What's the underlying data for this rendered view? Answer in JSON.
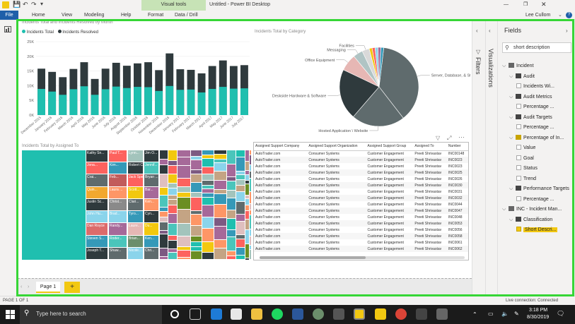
{
  "titlebar": {
    "title": "Untitled - Power BI Desktop",
    "user": "Lee Cullom"
  },
  "ribbon": {
    "tabs": [
      "File",
      "Home",
      "View",
      "Modeling",
      "Help",
      "Format",
      "Data / Drill"
    ],
    "context_group": "Visual tools"
  },
  "chart1": {
    "title": "Incidents Total and Incidents Resolved by Month",
    "legend": [
      "Incidents Total",
      "Incidents Resolved"
    ]
  },
  "chart2": {
    "title": "Incidents Total by Category"
  },
  "chart3": {
    "title": "Incidents Total by Assigned To"
  },
  "chart_data": [
    {
      "type": "bar",
      "title": "Incidents Total and Incidents Resolved by Month",
      "categories": [
        "December 2015",
        "January 2016",
        "February 2016",
        "March 2016",
        "April 2016",
        "May 2016",
        "June 2016",
        "July 2016",
        "August 2016",
        "September 2016",
        "October 2016",
        "November 2016",
        "December 2016",
        "January 2017",
        "February 2017",
        "March 2017",
        "April 2017",
        "May 2017",
        "June 2017",
        "July 2017"
      ],
      "y_ticks": [
        "0K",
        "5K",
        "10K",
        "15K",
        "20K",
        "25K"
      ],
      "ylim": [
        0,
        25000
      ],
      "series": [
        {
          "name": "Incidents Total",
          "color": "#2f3a3d",
          "values": [
            15800,
            14700,
            12900,
            15700,
            18000,
            12300,
            15800,
            17800,
            16800,
            17600,
            18000,
            15300,
            21000,
            15600,
            15400,
            14200,
            16700,
            18600,
            16700,
            17000
          ]
        },
        {
          "name": "Incidents Resolved",
          "color": "#1fbfaf",
          "values": [
            8900,
            8000,
            6900,
            8800,
            9800,
            6900,
            8800,
            9700,
            9200,
            9600,
            9500,
            8200,
            9900,
            8600,
            8700,
            7700,
            8900,
            9600,
            9000,
            9100
          ]
        }
      ]
    },
    {
      "type": "pie",
      "title": "Incidents Total by Category",
      "slices": [
        {
          "label": "Server, Database, & Storage",
          "value": 38,
          "color": "#5f6b6d"
        },
        {
          "label": "Hosted Application \\ Website",
          "value": 22,
          "color": "#5f6b6d"
        },
        {
          "label": "Deskside Hardware & Software",
          "value": 21,
          "color": "#2f3a3d"
        },
        {
          "label": "Office Equipment",
          "value": 7,
          "color": "#e6b7b4"
        },
        {
          "label": "Messaging",
          "value": 4,
          "color": "#b0c4c4"
        },
        {
          "label": "Facilities",
          "value": 3,
          "color": "#d9d9d9"
        },
        {
          "label": "",
          "value": 1.2,
          "color": "#f2c80f"
        },
        {
          "label": "",
          "value": 1.2,
          "color": "#fd625e"
        },
        {
          "label": "",
          "value": 1.2,
          "color": "#8ad4eb"
        },
        {
          "label": "",
          "value": 1.2,
          "color": "#a66999"
        },
        {
          "label": "",
          "value": 1.2,
          "color": "#3599b8"
        }
      ]
    }
  ],
  "treemap": {
    "names": [
      "Kathy Sn...",
      "Paul T...",
      "Lynn...",
      "Jim O...",
      "Jona...",
      "Kim...",
      "Robert C...",
      "Jennif...",
      "Crai...",
      "Feb...",
      "Jack Spe...",
      "Bryan ...",
      "Quin...",
      "Laura ...",
      "Scott...",
      "Bar...",
      "Justin Sc...",
      "Christ...",
      "Clari...",
      "Ken...",
      "John Hu...",
      "Brad...",
      "Tyro...",
      "Cyn...",
      "Dan Royce",
      "Randy...",
      "Laure...",
      "Du...",
      "Steven S...",
      "Roder...",
      "Brian...",
      "Ken...",
      "Joseph T...",
      "Shaw...",
      "Nicole...",
      "Chri..."
    ]
  },
  "table": {
    "columns": [
      "Assigned Support Company",
      "Assigned Support Organization",
      "Assigned Support Group",
      "Assigned To",
      "Number"
    ],
    "company": "AutoTrader.com",
    "org": "Consumer Systems",
    "group": "Customer Engagement",
    "assignee": "Preeti Shrivastav",
    "numbers": [
      "INC00148",
      "INC0023",
      "INC0023",
      "INC0025",
      "INC0026",
      "INC0030",
      "INC0031",
      "INC0032",
      "INC0044",
      "INC0047",
      "INC0048",
      "INC0053",
      "INC0056",
      "INC0058",
      "INC0061",
      "INC0062"
    ]
  },
  "pages": {
    "current": "Page 1",
    "add": "+"
  },
  "filters": {
    "label": "Filters"
  },
  "visualizations": {
    "label": "Visualizations"
  },
  "fields": {
    "title": "Fields",
    "search_value": "short description",
    "tree": [
      {
        "label": "Incident",
        "kind": "group",
        "indent": 0
      },
      {
        "label": "Audit",
        "kind": "table",
        "indent": 1
      },
      {
        "label": "Incidents Wi...",
        "kind": "field",
        "indent": 2
      },
      {
        "label": "Audit Metrics",
        "kind": "table",
        "indent": 1
      },
      {
        "label": "Percentage ...",
        "kind": "field",
        "indent": 2
      },
      {
        "label": "Audit Targets",
        "kind": "table",
        "indent": 1
      },
      {
        "label": "Percentage ...",
        "kind": "field",
        "indent": 2
      },
      {
        "label": "Percentage of In...",
        "kind": "ytable",
        "indent": 1
      },
      {
        "label": "Value",
        "kind": "field",
        "indent": 2
      },
      {
        "label": "Goal",
        "kind": "field",
        "indent": 2
      },
      {
        "label": "Status",
        "kind": "field",
        "indent": 2
      },
      {
        "label": "Trend",
        "kind": "field",
        "indent": 2
      },
      {
        "label": "Performance Targets",
        "kind": "table",
        "indent": 1
      },
      {
        "label": "Percentage ...",
        "kind": "field",
        "indent": 2
      },
      {
        "label": "INC - Incident Man...",
        "kind": "group",
        "indent": 0
      },
      {
        "label": "Classification",
        "kind": "table",
        "indent": 1
      },
      {
        "label": "Short Descri...",
        "kind": "highlight",
        "indent": 2
      }
    ]
  },
  "status": {
    "page": "PAGE 1 OF 1",
    "connection": "Live connection: Connected"
  },
  "taskbar": {
    "search": "Type here to search",
    "time": "3:18 PM",
    "date": "8/30/2019"
  },
  "colors": {
    "accent": "#1fbfaf",
    "dark": "#2f3a3d",
    "highlight": "#36d636",
    "brand": "#f2c811"
  }
}
